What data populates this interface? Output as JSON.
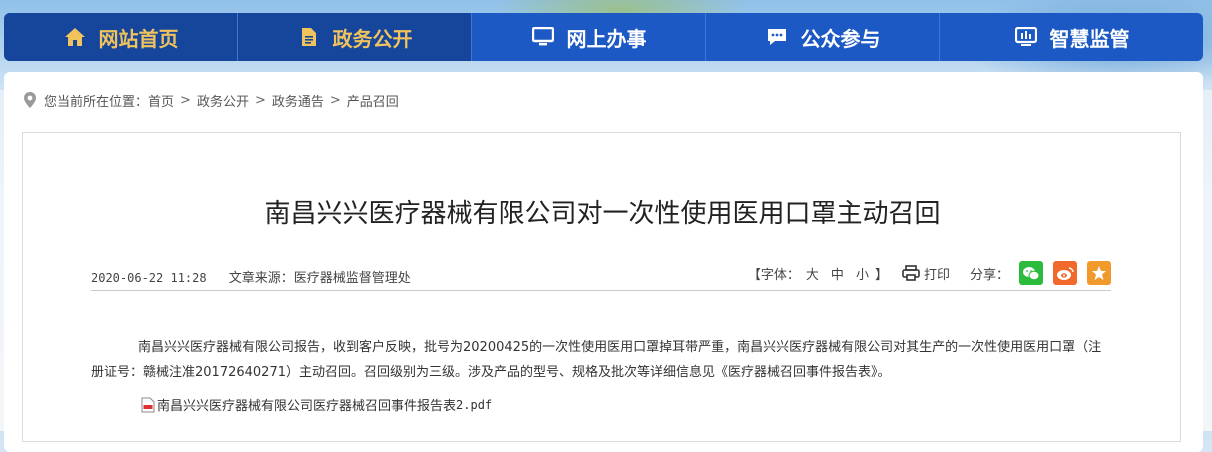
{
  "nav": {
    "items": [
      {
        "label": "网站首页",
        "icon": "home-icon"
      },
      {
        "label": "政务公开",
        "icon": "document-icon"
      },
      {
        "label": "网上办事",
        "icon": "monitor-icon"
      },
      {
        "label": "公众参与",
        "icon": "chat-icon"
      },
      {
        "label": "智慧监管",
        "icon": "dashboard-icon"
      }
    ]
  },
  "breadcrumb": {
    "prefix": "您当前所在位置：",
    "items": [
      "首页",
      "政务公开",
      "政务通告",
      "产品召回"
    ],
    "separator": ">"
  },
  "article": {
    "title": "南昌兴兴医疗器械有限公司对一次性使用医用口罩主动召回",
    "date": "2020-06-22 11:28",
    "source": "文章来源：医疗器械监督管理处",
    "font_size_label": "【字体：",
    "font_size_options": [
      "大",
      "中",
      "小"
    ],
    "font_size_close": "】",
    "print_label": "打印",
    "share_label": "分享：",
    "share_buttons": [
      {
        "name": "wechat-icon",
        "color": "#2dbb3d"
      },
      {
        "name": "weibo-icon",
        "color": "#f1692b"
      },
      {
        "name": "favorite-star-icon",
        "color": "#f19a2c"
      }
    ],
    "body": "南昌兴兴医疗器械有限公司报告，收到客户反映，批号为20200425的一次性使用医用口罩掉耳带严重，南昌兴兴医疗器械有限公司对其生产的一次性使用医用口罩（注册证号：赣械注准20172640271）主动召回。召回级别为三级。涉及产品的型号、规格及批次等详细信息见《医疗器械召回事件报告表》。",
    "attachment_name": "南昌兴兴医疗器械有限公司医疗器械召回事件报告表",
    "attachment_suffix": "2.pdf"
  },
  "colors": {
    "nav_blue": "#1c59c4",
    "nav_active": "#15469c",
    "nav_gold": "#f1c35c"
  }
}
